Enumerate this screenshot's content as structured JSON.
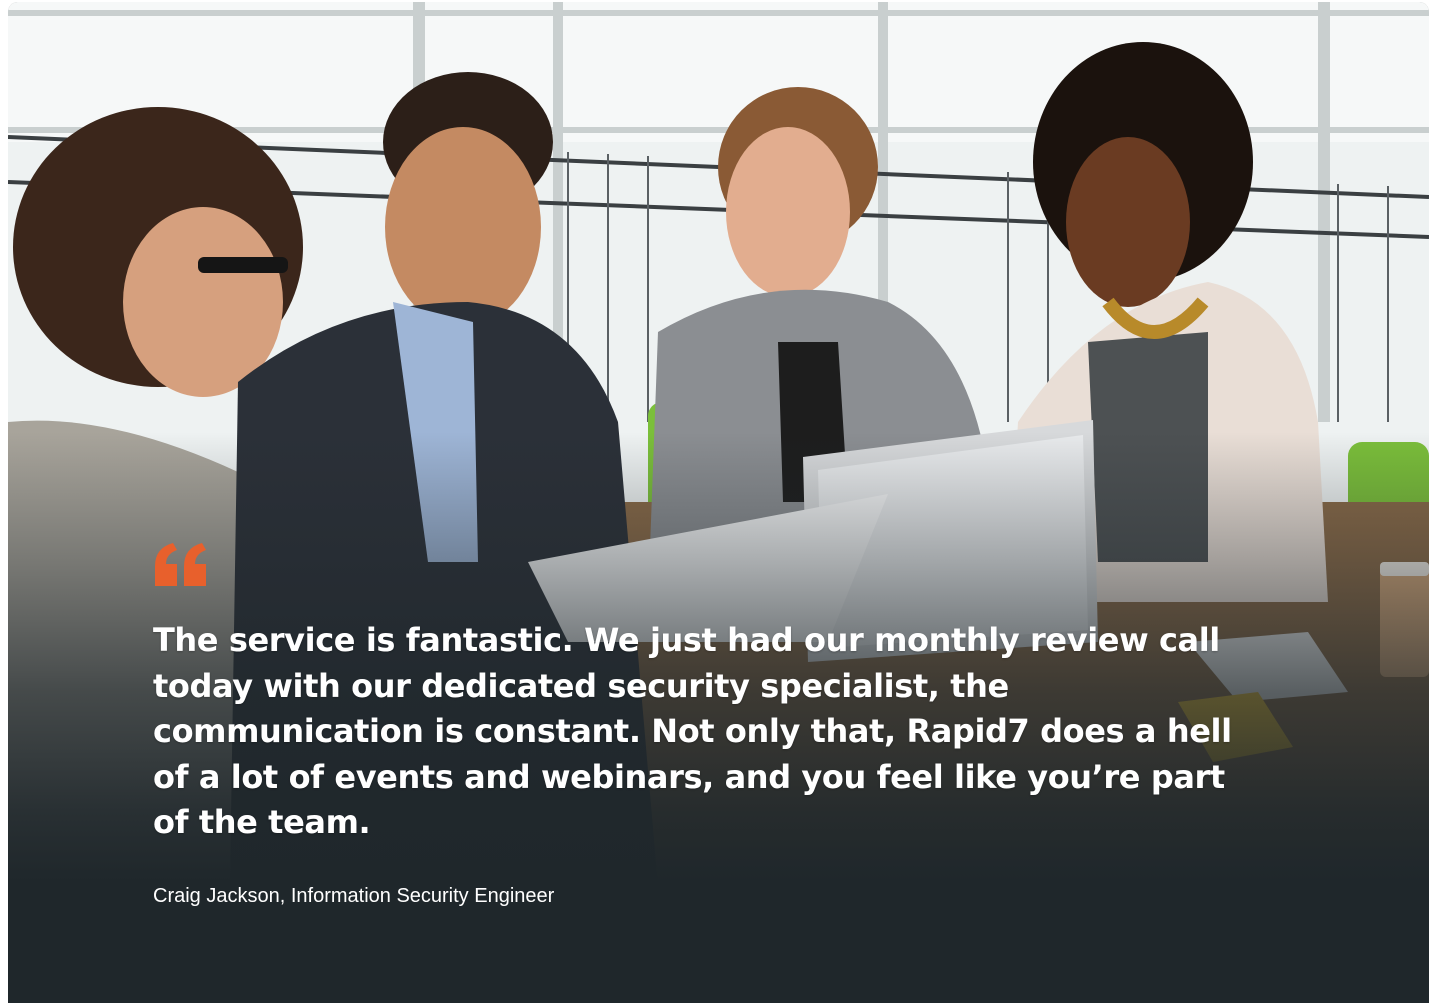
{
  "testimonial": {
    "quote": "The service is fantastic. We just had our monthly review call today with our dedicated security specialist, the communication is constant. Not only that, Rapid7 does a hell of a lot of events and webinars, and you feel like you’re part of the team.",
    "attribution": "Craig Jackson, Information Security Engineer",
    "quote_icon": "quote-open-icon"
  },
  "colors": {
    "accent": "#e8602c",
    "overlay": "#1f272b",
    "text": "#ffffff"
  }
}
